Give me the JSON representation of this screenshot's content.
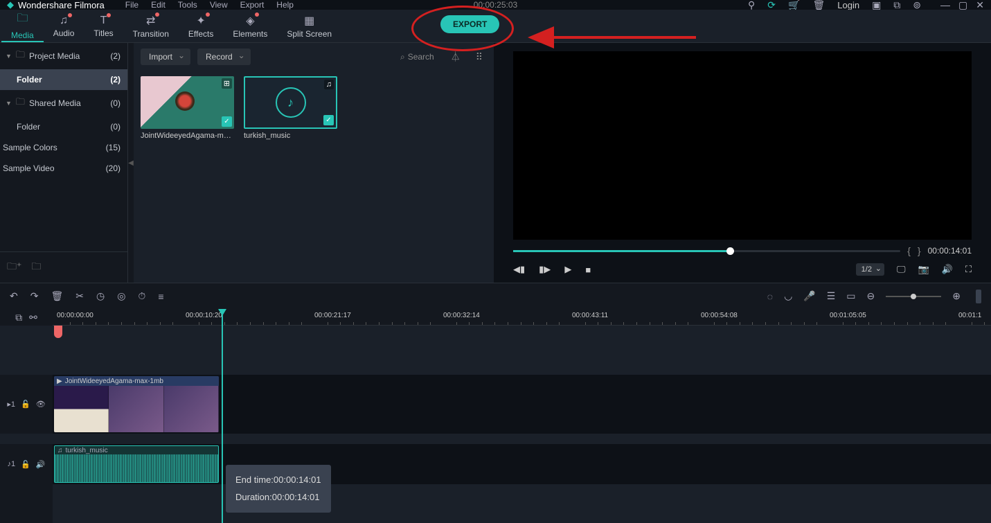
{
  "titlebar": {
    "app_name": "Wondershare Filmora",
    "menus": [
      "File",
      "Edit",
      "Tools",
      "View",
      "Export",
      "Help"
    ],
    "project_time": "00:00:25:03",
    "login": "Login"
  },
  "tabs": [
    {
      "label": "Media",
      "icon": "🗀",
      "active": true,
      "dot": false
    },
    {
      "label": "Audio",
      "icon": "♫",
      "active": false,
      "dot": true
    },
    {
      "label": "Titles",
      "icon": "T",
      "active": false,
      "dot": true
    },
    {
      "label": "Transition",
      "icon": "⇄",
      "active": false,
      "dot": true
    },
    {
      "label": "Effects",
      "icon": "✦",
      "active": false,
      "dot": true
    },
    {
      "label": "Elements",
      "icon": "◈",
      "active": false,
      "dot": true
    },
    {
      "label": "Split Screen",
      "icon": "▦",
      "active": false,
      "dot": false
    }
  ],
  "export_label": "EXPORT",
  "sidebar": {
    "items": [
      {
        "label": "Project Media",
        "count": "(2)",
        "caret": true,
        "folder": true
      },
      {
        "label": "Folder",
        "count": "(2)",
        "active": true,
        "indent": true
      },
      {
        "label": "Shared Media",
        "count": "(0)",
        "caret": true,
        "folder": true
      },
      {
        "label": "Folder",
        "count": "(0)",
        "indent": true
      },
      {
        "label": "Sample Colors",
        "count": "(15)"
      },
      {
        "label": "Sample Video",
        "count": "(20)"
      }
    ]
  },
  "media_toolbar": {
    "import": "Import",
    "record": "Record",
    "search_placeholder": "Search"
  },
  "media_items": [
    {
      "label": "JointWideeyedAgama-ma...",
      "type": "video"
    },
    {
      "label": "turkish_music",
      "type": "audio"
    }
  ],
  "preview": {
    "time": "00:00:14:01",
    "ratio": "1/2"
  },
  "ruler_ticks": [
    {
      "label": "00:00:00:00",
      "pos": 6
    },
    {
      "label": "00:00:10:20",
      "pos": 192
    },
    {
      "label": "00:00:21:17",
      "pos": 378
    },
    {
      "label": "00:00:32:14",
      "pos": 564
    },
    {
      "label": "00:00:43:11",
      "pos": 750
    },
    {
      "label": "00:00:54:08",
      "pos": 936
    },
    {
      "label": "00:01:05:05",
      "pos": 1122
    },
    {
      "label": "00:01:1",
      "pos": 1308
    }
  ],
  "clips": {
    "video_label": "JointWideeyedAgama-max-1mb",
    "audio_label": "turkish_music"
  },
  "tooltip": {
    "end_label": "End time:",
    "end_value": "00:00:14:01",
    "dur_label": "Duration:",
    "dur_value": "00:00:14:01"
  }
}
